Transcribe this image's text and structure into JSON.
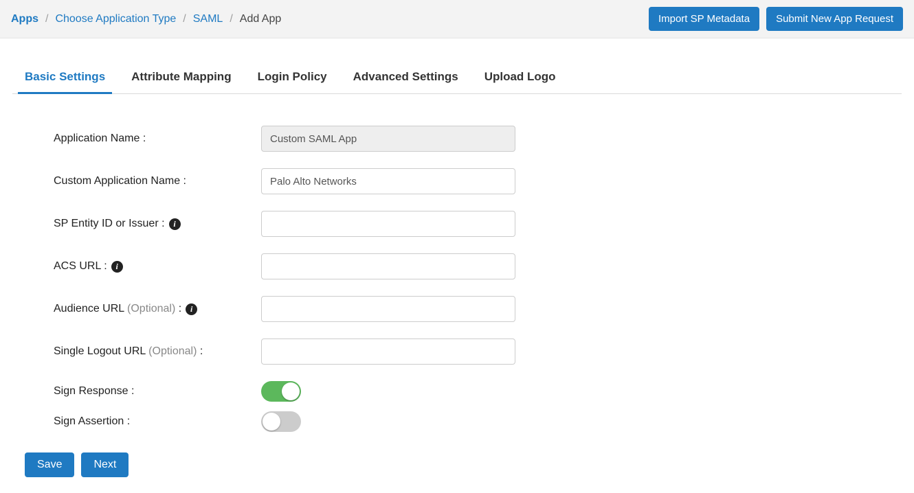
{
  "breadcrumb": {
    "apps": "Apps",
    "choose_type": "Choose Application Type",
    "saml": "SAML",
    "current": "Add App"
  },
  "top_buttons": {
    "import": "Import SP Metadata",
    "submit": "Submit New App Request"
  },
  "tabs": {
    "basic": "Basic Settings",
    "attribute": "Attribute Mapping",
    "login": "Login Policy",
    "advanced": "Advanced Settings",
    "upload": "Upload Logo"
  },
  "form": {
    "app_name_label": "Application Name :",
    "app_name_value": "Custom SAML App",
    "custom_name_label": "Custom Application Name :",
    "custom_name_value": "Palo Alto Networks",
    "sp_entity_label": "SP Entity ID or Issuer :",
    "sp_entity_value": "",
    "acs_label": "ACS URL :",
    "acs_value": "",
    "audience_label": "Audience URL ",
    "audience_optional": "(Optional)",
    "audience_colon": " :",
    "audience_value": "",
    "slo_label": "Single Logout URL ",
    "slo_optional": "(Optional)",
    "slo_colon": " :",
    "slo_value": "",
    "sign_response_label": "Sign Response :",
    "sign_assertion_label": "Sign Assertion :"
  },
  "footer": {
    "save": "Save",
    "next": "Next"
  },
  "icons": {
    "info": "i"
  }
}
